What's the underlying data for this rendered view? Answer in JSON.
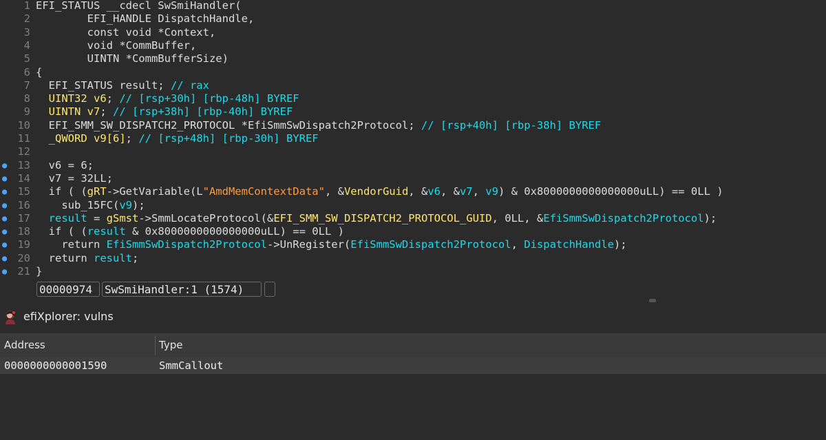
{
  "colors": {
    "text": "#dcdcdc",
    "cyan": "#20d8e8",
    "yellow": "#ffe66b",
    "string": "#ff9a3d",
    "linenum": "#7e7e7e",
    "breakpoint": "#4aa3ff"
  },
  "code_lines": [
    {
      "n": "1",
      "bp": false,
      "segs": [
        [
          "w",
          "EFI_STATUS __cdecl SwSmiHandler("
        ]
      ]
    },
    {
      "n": "2",
      "bp": false,
      "segs": [
        [
          "w",
          "        EFI_HANDLE DispatchHandle,"
        ]
      ]
    },
    {
      "n": "3",
      "bp": false,
      "segs": [
        [
          "w",
          "        const void *Context,"
        ]
      ]
    },
    {
      "n": "4",
      "bp": false,
      "segs": [
        [
          "w",
          "        void *CommBuffer,"
        ]
      ]
    },
    {
      "n": "5",
      "bp": false,
      "segs": [
        [
          "w",
          "        UINTN *CommBufferSize)"
        ]
      ]
    },
    {
      "n": "6",
      "bp": false,
      "segs": [
        [
          "w",
          "{"
        ]
      ]
    },
    {
      "n": "7",
      "bp": false,
      "segs": [
        [
          "w",
          "  EFI_STATUS result; "
        ],
        [
          "c",
          "// rax"
        ]
      ]
    },
    {
      "n": "8",
      "bp": false,
      "segs": [
        [
          "w",
          "  "
        ],
        [
          "y",
          "UINT32 v6"
        ],
        [
          "w",
          "; "
        ],
        [
          "c",
          "// [rsp+30h] [rbp-48h] BYREF"
        ]
      ]
    },
    {
      "n": "9",
      "bp": false,
      "segs": [
        [
          "w",
          "  "
        ],
        [
          "y",
          "UINTN v7"
        ],
        [
          "w",
          "; "
        ],
        [
          "c",
          "// [rsp+38h] [rbp-40h] BYREF"
        ]
      ]
    },
    {
      "n": "10",
      "bp": false,
      "segs": [
        [
          "w",
          "  EFI_SMM_SW_DISPATCH2_PROTOCOL *EfiSmmSwDispatch2Protocol; "
        ],
        [
          "c",
          "// [rsp+40h] [rbp-38h] BYREF"
        ]
      ]
    },
    {
      "n": "11",
      "bp": false,
      "segs": [
        [
          "w",
          "  "
        ],
        [
          "y",
          "_QWORD v9[6]"
        ],
        [
          "w",
          "; "
        ],
        [
          "c",
          "// [rsp+48h] [rbp-30h] BYREF"
        ]
      ]
    },
    {
      "n": "12",
      "bp": false,
      "segs": [
        [
          "w",
          ""
        ]
      ]
    },
    {
      "n": "13",
      "bp": true,
      "segs": [
        [
          "w",
          "  v6 = 6;"
        ]
      ]
    },
    {
      "n": "14",
      "bp": true,
      "segs": [
        [
          "w",
          "  v7 = 32LL;"
        ]
      ]
    },
    {
      "n": "15",
      "bp": true,
      "segs": [
        [
          "w",
          "  if ( ("
        ],
        [
          "y",
          "gRT"
        ],
        [
          "w",
          "->GetVariable(L"
        ],
        [
          "s",
          "\"AmdMemContextData\""
        ],
        [
          "w",
          ", &"
        ],
        [
          "y",
          "VendorGuid"
        ],
        [
          "w",
          ", &"
        ],
        [
          "c",
          "v6"
        ],
        [
          "w",
          ", &"
        ],
        [
          "c",
          "v7"
        ],
        [
          "w",
          ", "
        ],
        [
          "c",
          "v9"
        ],
        [
          "w",
          ") & 0x8000000000000000uLL) == 0LL )"
        ]
      ]
    },
    {
      "n": "16",
      "bp": true,
      "segs": [
        [
          "w",
          "    sub_15FC("
        ],
        [
          "c",
          "v9"
        ],
        [
          "w",
          ");"
        ]
      ]
    },
    {
      "n": "17",
      "bp": true,
      "segs": [
        [
          "w",
          "  "
        ],
        [
          "c",
          "result"
        ],
        [
          "w",
          " = "
        ],
        [
          "y",
          "gSmst"
        ],
        [
          "w",
          "->SmmLocateProtocol(&"
        ],
        [
          "y",
          "EFI_SMM_SW_DISPATCH2_PROTOCOL_GUID"
        ],
        [
          "w",
          ", 0LL, &"
        ],
        [
          "c",
          "EfiSmmSwDispatch2Protocol"
        ],
        [
          "w",
          ");"
        ]
      ]
    },
    {
      "n": "18",
      "bp": true,
      "segs": [
        [
          "w",
          "  if ( ("
        ],
        [
          "c",
          "result"
        ],
        [
          "w",
          " & 0x8000000000000000uLL) == 0LL )"
        ]
      ]
    },
    {
      "n": "19",
      "bp": true,
      "segs": [
        [
          "w",
          "    return "
        ],
        [
          "c",
          "EfiSmmSwDispatch2Protocol"
        ],
        [
          "w",
          "->UnRegister("
        ],
        [
          "c",
          "EfiSmmSwDispatch2Protocol"
        ],
        [
          "w",
          ", "
        ],
        [
          "c",
          "DispatchHandle"
        ],
        [
          "w",
          ");"
        ]
      ]
    },
    {
      "n": "20",
      "bp": true,
      "segs": [
        [
          "w",
          "  return "
        ],
        [
          "c",
          "result"
        ],
        [
          "w",
          ";"
        ]
      ]
    },
    {
      "n": "21",
      "bp": true,
      "segs": [
        [
          "w",
          "}"
        ]
      ]
    }
  ],
  "status": {
    "address": "00000974",
    "location": "SwSmiHandler:1 (1574)"
  },
  "panel": {
    "title": "efiXplorer: vulns",
    "columns": [
      "Address",
      "Type"
    ],
    "rows": [
      {
        "address": "0000000000001590",
        "type": "SmmCallout"
      }
    ]
  }
}
